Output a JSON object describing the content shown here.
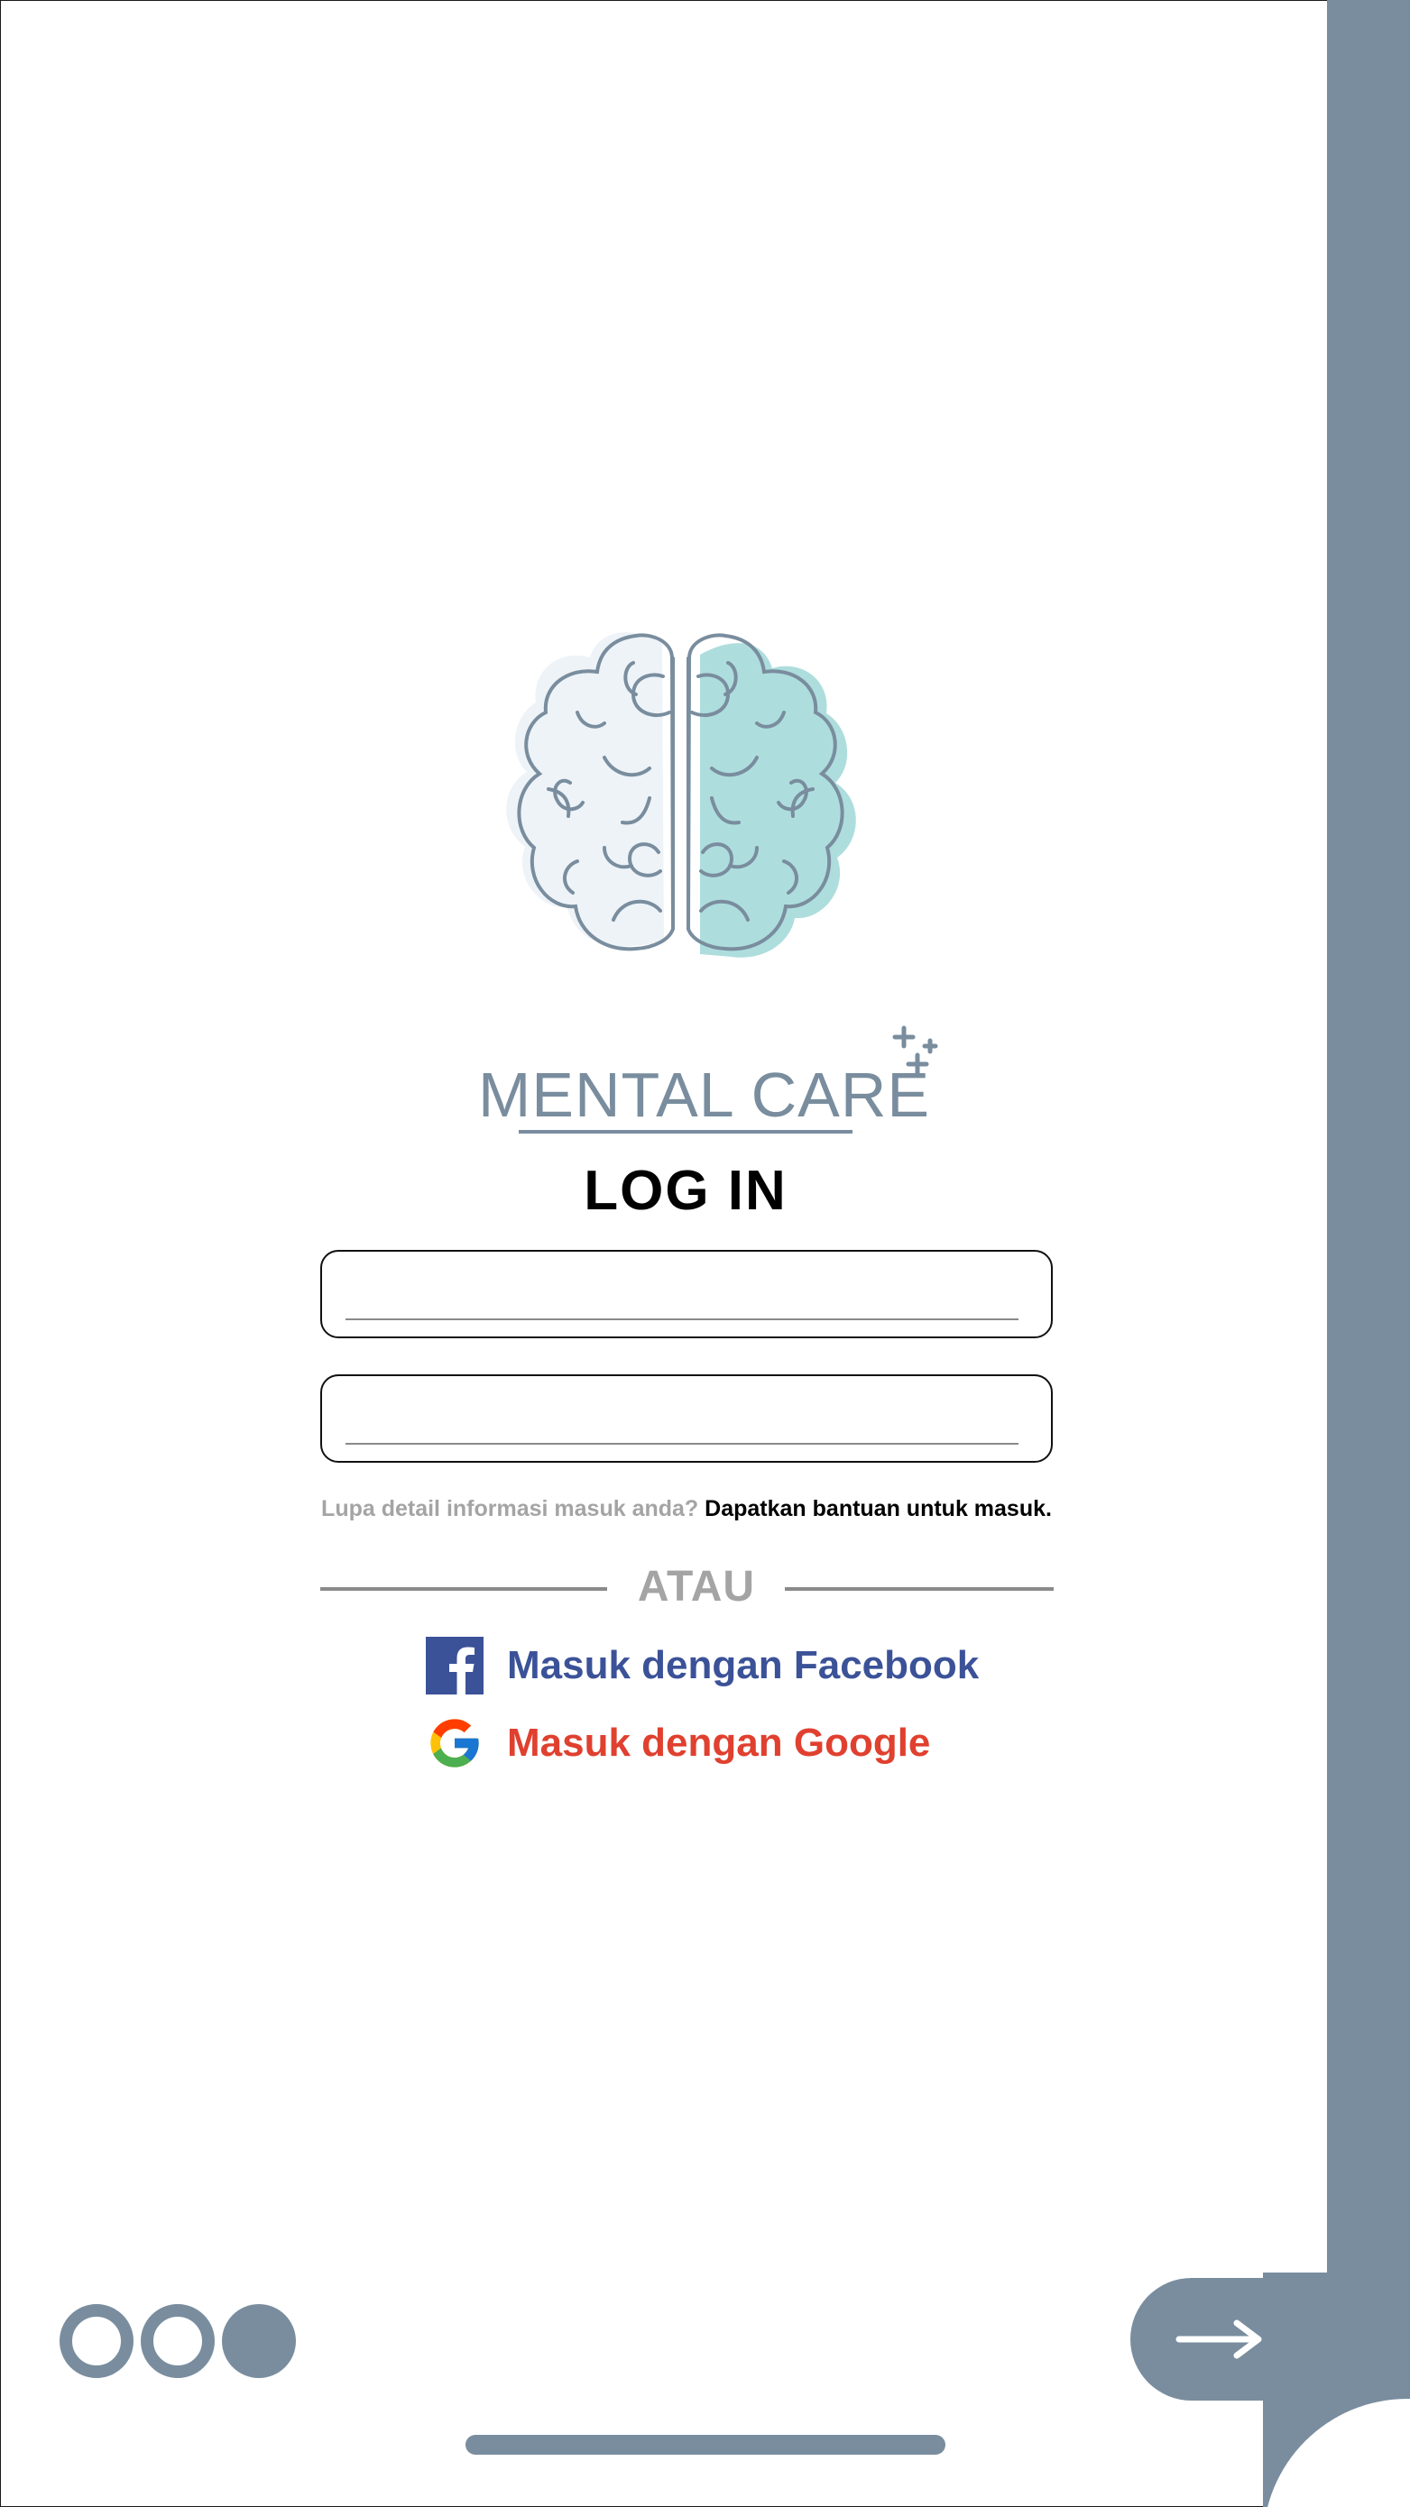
{
  "app": {
    "brand": "MENTAL CARE"
  },
  "login": {
    "title": "LOG IN",
    "username_placeholder": "",
    "password_placeholder": ""
  },
  "help": {
    "question": "Lupa detail informasi masuk anda?",
    "link": "Dapatkan bantuan  untuk masuk."
  },
  "divider": {
    "label": "ATAU"
  },
  "social": {
    "facebook_label": "Masuk dengan Facebook",
    "google_label": "Masuk dengan Google"
  },
  "pagination": {
    "total": 3,
    "current": 3
  },
  "icons": {
    "logo": "brain-logo-icon",
    "facebook": "facebook-icon",
    "google": "google-icon",
    "next": "arrow-right-icon"
  },
  "colors": {
    "accent": "#798d9e",
    "brain_left": "#eef3f8",
    "brain_right": "#aedddd",
    "facebook": "#3b5298",
    "google": "#e0402f",
    "muted_text": "#a4a4a4"
  }
}
